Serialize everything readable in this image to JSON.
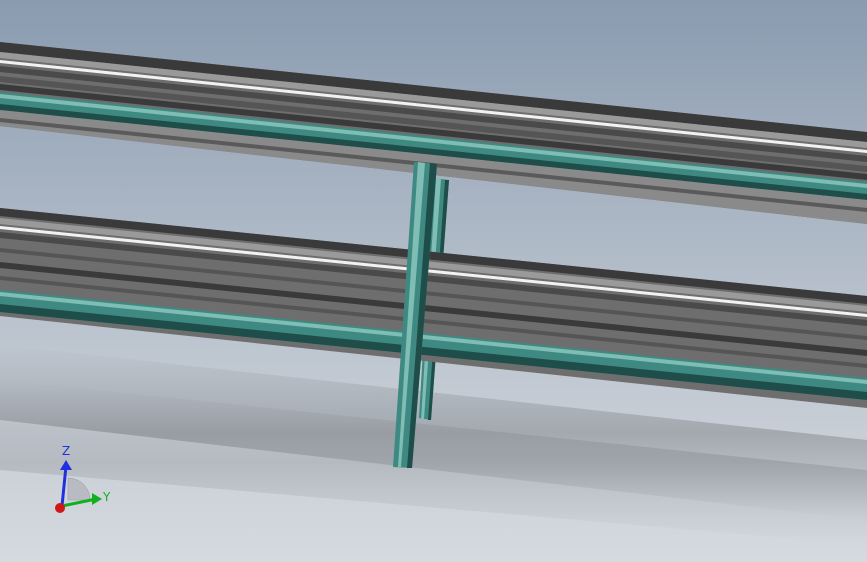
{
  "viewport": {
    "background_top": "#8a9bb0",
    "background_bottom": "#d6dadf"
  },
  "colors": {
    "rail_gray": "#6e6e6e",
    "rail_dark": "#3a3a3a",
    "rail_light": "#9a9a9a",
    "rail_highlight": "#f2f2f2",
    "teal": "#3e8a82",
    "teal_light": "#7fbdb5",
    "teal_dark": "#1f4d49"
  },
  "triad": {
    "z_label": "Z",
    "y_label": "Y",
    "z_color": "#2030e0",
    "y_color": "#10b020",
    "x_color": "#d01818"
  }
}
